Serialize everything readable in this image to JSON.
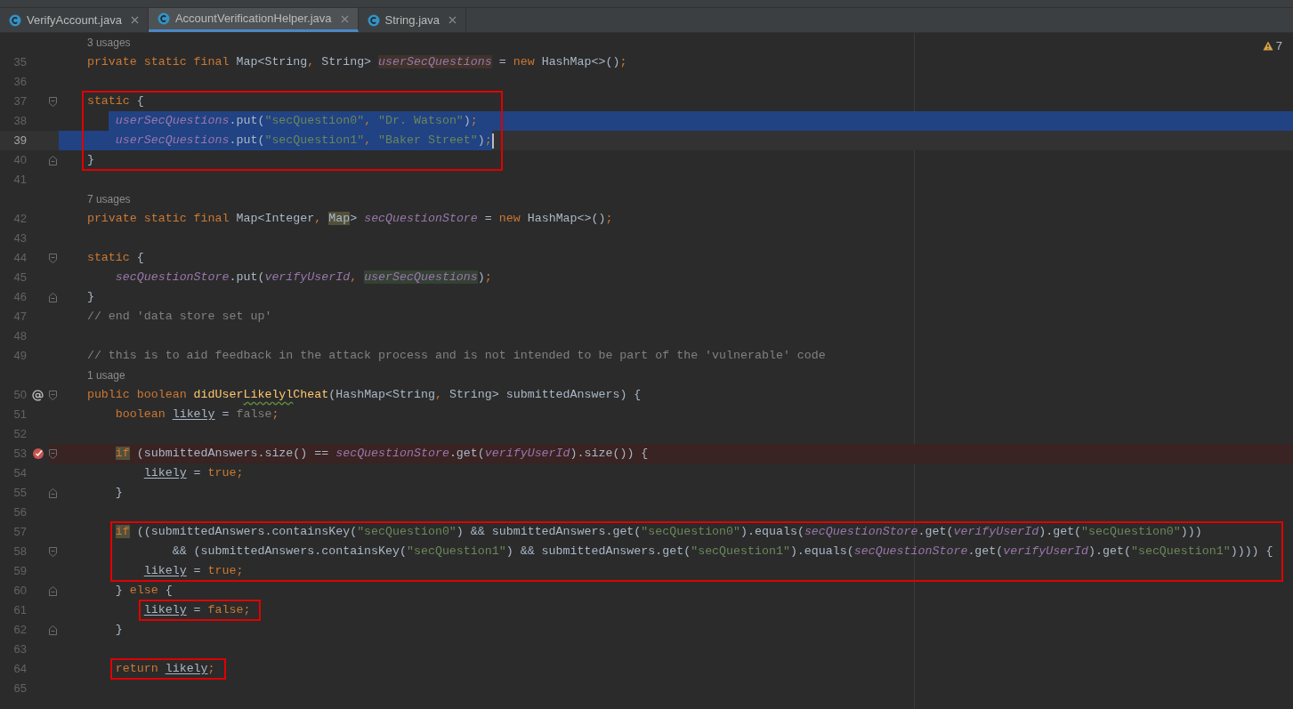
{
  "tabs": [
    {
      "label": "VerifyAccount.java",
      "selected": false
    },
    {
      "label": "AccountVerificationHelper.java",
      "selected": true
    },
    {
      "label": "String.java",
      "selected": false
    }
  ],
  "inspections": {
    "warnings": "7"
  },
  "lines": [
    {
      "kind": "hint",
      "text": "3 usages"
    },
    {
      "kind": "code",
      "number": "35",
      "tokens": [
        {
          "text": "private static final",
          "kind": "kw"
        },
        {
          "text": " Map<String",
          "kind": "plain"
        },
        {
          "text": ",",
          "kind": "kw"
        },
        {
          "text": " String> ",
          "kind": "plain"
        },
        {
          "text": "userSecQuestions",
          "kind": "field-write"
        },
        {
          "text": " = ",
          "kind": "plain"
        },
        {
          "text": "new",
          "kind": "kw"
        },
        {
          "text": " HashMap<>()",
          "kind": "plain"
        },
        {
          "text": ";",
          "kind": "kw"
        }
      ]
    },
    {
      "kind": "code",
      "number": "36"
    },
    {
      "kind": "code",
      "number": "37",
      "fold_start": true,
      "boxed": true,
      "tokens": [
        {
          "text": "static",
          "kind": "kw"
        },
        {
          "text": " {",
          "kind": "plain"
        }
      ],
      "children": [
        {
          "kind": "code",
          "number": "38",
          "selected": true,
          "boxed": true,
          "tokens": [
            {
              "text": "userSecQuestions",
              "kind": "field"
            },
            {
              "text": ".put(",
              "kind": "plain"
            },
            {
              "text": "\"secQuestion0\"",
              "kind": "str"
            },
            {
              "text": ", ",
              "kind": "kw"
            },
            {
              "text": "\"Dr. Watson\"",
              "kind": "str"
            },
            {
              "text": ")",
              "kind": "plain"
            },
            {
              "text": ";",
              "kind": "kw"
            }
          ]
        },
        {
          "kind": "code",
          "number": "39",
          "selected": true,
          "caret": true,
          "boxed": true,
          "tokens": [
            {
              "text": "userSecQuestions",
              "kind": "field"
            },
            {
              "text": ".put(",
              "kind": "plain"
            },
            {
              "text": "\"secQuestion1\"",
              "kind": "str"
            },
            {
              "text": ", ",
              "kind": "kw"
            },
            {
              "text": "\"Baker Street\"",
              "kind": "str"
            },
            {
              "text": ")",
              "kind": "plain"
            },
            {
              "text": ";",
              "kind": "kw"
            }
          ]
        }
      ]
    },
    {
      "kind": "code",
      "number": "40",
      "fold_end": true,
      "boxed": true,
      "tokens": [
        {
          "text": "}",
          "kind": "plain"
        }
      ]
    },
    {
      "kind": "code",
      "number": "41"
    },
    {
      "kind": "hint",
      "text": "7 usages"
    },
    {
      "kind": "code",
      "number": "42",
      "tokens": [
        {
          "text": "private static final",
          "kind": "kw"
        },
        {
          "text": " Map<Integer",
          "kind": "plain"
        },
        {
          "text": ", ",
          "kind": "kw"
        },
        {
          "text": "Map",
          "kind": "plain-match"
        },
        {
          "text": "> ",
          "kind": "plain"
        },
        {
          "text": "secQuestionStore",
          "kind": "field"
        },
        {
          "text": " = ",
          "kind": "plain"
        },
        {
          "text": "new",
          "kind": "kw"
        },
        {
          "text": " HashMap<>()",
          "kind": "plain"
        },
        {
          "text": ";",
          "kind": "kw"
        }
      ]
    },
    {
      "kind": "code",
      "number": "43"
    },
    {
      "kind": "code",
      "number": "44",
      "fold_start": true,
      "tokens": [
        {
          "text": "static",
          "kind": "kw"
        },
        {
          "text": " {",
          "kind": "plain"
        }
      ],
      "children": [
        {
          "kind": "code",
          "number": "45",
          "tokens": [
            {
              "text": "secQuestionStore",
              "kind": "field"
            },
            {
              "text": ".put(",
              "kind": "plain"
            },
            {
              "text": "verifyUserId",
              "kind": "field"
            },
            {
              "text": ", ",
              "kind": "kw"
            },
            {
              "text": "userSecQuestions",
              "kind": "field-read"
            },
            {
              "text": ")",
              "kind": "plain"
            },
            {
              "text": ";",
              "kind": "kw"
            }
          ]
        }
      ]
    },
    {
      "kind": "code",
      "number": "46",
      "fold_end": true,
      "tokens": [
        {
          "text": "}",
          "kind": "plain"
        }
      ]
    },
    {
      "kind": "code",
      "number": "47",
      "tokens": [
        {
          "text": "// end 'data store set up'",
          "kind": "comment"
        }
      ]
    },
    {
      "kind": "code",
      "number": "48"
    },
    {
      "kind": "code",
      "number": "49",
      "tokens": [
        {
          "text": "// this is to aid feedback in the attack process and is not intended to be part of the 'vulnerable' code",
          "kind": "comment"
        }
      ]
    },
    {
      "kind": "hint",
      "text": "1 usage"
    },
    {
      "kind": "code",
      "number": "50",
      "override": true,
      "fold_start": true,
      "tokens": [
        {
          "text": "public boolean ",
          "kind": "kw"
        },
        {
          "text": "didUser",
          "kind": "method"
        },
        {
          "text": "Likelyl",
          "kind": "method",
          "typo": true
        },
        {
          "text": "Cheat",
          "kind": "method"
        },
        {
          "text": "(HashMap<String",
          "kind": "plain"
        },
        {
          "text": ",",
          "kind": "kw"
        },
        {
          "text": " String> submittedAnswers) {",
          "kind": "plain"
        }
      ],
      "children": [
        {
          "kind": "code",
          "number": "51",
          "tokens": [
            {
              "text": "boolean ",
              "kind": "kw"
            },
            {
              "text": "likely",
              "kind": "reassigned"
            },
            {
              "text": " = ",
              "kind": "plain"
            },
            {
              "text": "false",
              "kind": "unused"
            },
            {
              "text": ";",
              "kind": "kw"
            }
          ]
        },
        {
          "kind": "code",
          "number": "52"
        },
        {
          "kind": "code",
          "number": "53",
          "breakpoint": true,
          "fold_start": true,
          "tokens": [
            {
              "text": "if",
              "kind": "kw-match"
            },
            {
              "text": " (submittedAnswers.size() == ",
              "kind": "plain"
            },
            {
              "text": "secQuestionStore",
              "kind": "field"
            },
            {
              "text": ".get(",
              "kind": "plain"
            },
            {
              "text": "verifyUserId",
              "kind": "field"
            },
            {
              "text": ").size()) {",
              "kind": "plain"
            }
          ],
          "children": [
            {
              "kind": "code",
              "number": "54",
              "tokens": [
                {
                  "text": "likely",
                  "kind": "reassigned"
                },
                {
                  "text": " = ",
                  "kind": "plain"
                },
                {
                  "text": "true",
                  "kind": "kw"
                },
                {
                  "text": ";",
                  "kind": "kw"
                }
              ]
            }
          ]
        },
        {
          "kind": "code",
          "number": "55",
          "fold_end": true,
          "tokens": [
            {
              "text": "}",
              "kind": "plain"
            }
          ]
        },
        {
          "kind": "code",
          "number": "56"
        },
        {
          "kind": "code",
          "number": "57",
          "boxed": true,
          "tokens": [
            {
              "text": "if",
              "kind": "kw-match"
            },
            {
              "text": " ((submittedAnswers.containsKey(",
              "kind": "plain"
            },
            {
              "text": "\"secQuestion0\"",
              "kind": "str"
            },
            {
              "text": ") && submittedAnswers.get(",
              "kind": "plain"
            },
            {
              "text": "\"secQuestion0\"",
              "kind": "str"
            },
            {
              "text": ").equals(",
              "kind": "plain"
            },
            {
              "text": "secQuestionStore",
              "kind": "field"
            },
            {
              "text": ".get(",
              "kind": "plain"
            },
            {
              "text": "verifyUserId",
              "kind": "field"
            },
            {
              "text": ").get(",
              "kind": "plain"
            },
            {
              "text": "\"secQuestion0\"",
              "kind": "str"
            },
            {
              "text": ")))",
              "kind": "plain"
            }
          ]
        },
        {
          "kind": "code",
          "number": "58",
          "continuation": true,
          "fold_start": true,
          "boxed": true,
          "tokens": [
            {
              "text": "&& (submittedAnswers.containsKey(",
              "kind": "plain"
            },
            {
              "text": "\"secQuestion1\"",
              "kind": "str"
            },
            {
              "text": ") && submittedAnswers.get(",
              "kind": "plain"
            },
            {
              "text": "\"secQuestion1\"",
              "kind": "str"
            },
            {
              "text": ").equals(",
              "kind": "plain"
            },
            {
              "text": "secQuestionStore",
              "kind": "field"
            },
            {
              "text": ".get(",
              "kind": "plain"
            },
            {
              "text": "verifyUserId",
              "kind": "field"
            },
            {
              "text": ").get(",
              "kind": "plain"
            },
            {
              "text": "\"secQuestion1\"",
              "kind": "str"
            },
            {
              "text": ")))) {",
              "kind": "plain"
            }
          ],
          "children": [
            {
              "kind": "code",
              "number": "59",
              "boxed": true,
              "tokens": [
                {
                  "text": "likely",
                  "kind": "reassigned"
                },
                {
                  "text": " = ",
                  "kind": "plain"
                },
                {
                  "text": "true",
                  "kind": "kw"
                },
                {
                  "text": ";",
                  "kind": "kw"
                }
              ]
            }
          ]
        },
        {
          "kind": "code",
          "number": "60",
          "fold_end": true,
          "tokens": [
            {
              "text": "} ",
              "kind": "plain"
            },
            {
              "text": "else",
              "kind": "kw"
            },
            {
              "text": " {",
              "kind": "plain"
            }
          ],
          "children": [
            {
              "kind": "code",
              "number": "61",
              "boxed": true,
              "tokens": [
                {
                  "text": "likely",
                  "kind": "reassigned"
                },
                {
                  "text": " = ",
                  "kind": "plain"
                },
                {
                  "text": "false",
                  "kind": "kw"
                },
                {
                  "text": ";",
                  "kind": "kw"
                }
              ]
            }
          ]
        },
        {
          "kind": "code",
          "number": "62",
          "fold_end": true,
          "tokens": [
            {
              "text": "}",
              "kind": "plain"
            }
          ]
        },
        {
          "kind": "code",
          "number": "63"
        },
        {
          "kind": "code",
          "number": "64",
          "boxed": true,
          "tokens": [
            {
              "text": "return ",
              "kind": "kw"
            },
            {
              "text": "likely",
              "kind": "reassigned"
            },
            {
              "text": ";",
              "kind": "kw"
            }
          ]
        },
        {
          "kind": "code",
          "number": "65"
        }
      ]
    }
  ]
}
